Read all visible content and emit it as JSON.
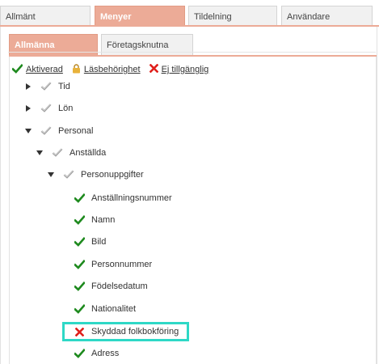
{
  "top_tabs": [
    {
      "label": "Allmänt",
      "active": false
    },
    {
      "label": "Menyer",
      "active": true
    },
    {
      "label": "Tildelning",
      "active": false
    },
    {
      "label": "Användare",
      "active": false
    }
  ],
  "sub_tabs": [
    {
      "label": "Allmänna",
      "active": true
    },
    {
      "label": "Företagsknutna",
      "active": false
    }
  ],
  "legend": {
    "activated": "Aktiverad",
    "read_permission": "Läsbehörighet",
    "unavailable": "Ej tillgänglig"
  },
  "colors": {
    "accent": "#ecab97",
    "check_green": "#1e8a1e",
    "cross_red": "#e0201c",
    "lock_gold": "#e8b23a",
    "highlight": "#2ed8c6"
  },
  "tree": [
    {
      "label": "Tid",
      "arrow": "collapsed",
      "status": "partial-icon"
    },
    {
      "label": "Lön",
      "arrow": "collapsed",
      "status": "partial-icon"
    },
    {
      "label": "Personal",
      "arrow": "expanded",
      "status": "partial-icon"
    },
    {
      "label": "Anställda",
      "arrow": "expanded",
      "status": "partial-icon"
    },
    {
      "label": "Personuppgifter",
      "arrow": "expanded",
      "status": "partial-icon"
    },
    {
      "label": "Anställningsnummer",
      "status": "check-icon"
    },
    {
      "label": "Namn",
      "status": "check-icon"
    },
    {
      "label": "Bild",
      "status": "check-icon"
    },
    {
      "label": "Personnummer",
      "status": "check-icon"
    },
    {
      "label": "Födelsedatum",
      "status": "check-icon"
    },
    {
      "label": "Nationalitet",
      "status": "check-icon"
    },
    {
      "label": "Skyddad folkbokföring",
      "status": "cross-icon",
      "highlighted": true
    },
    {
      "label": "Adress",
      "status": "check-icon"
    }
  ]
}
